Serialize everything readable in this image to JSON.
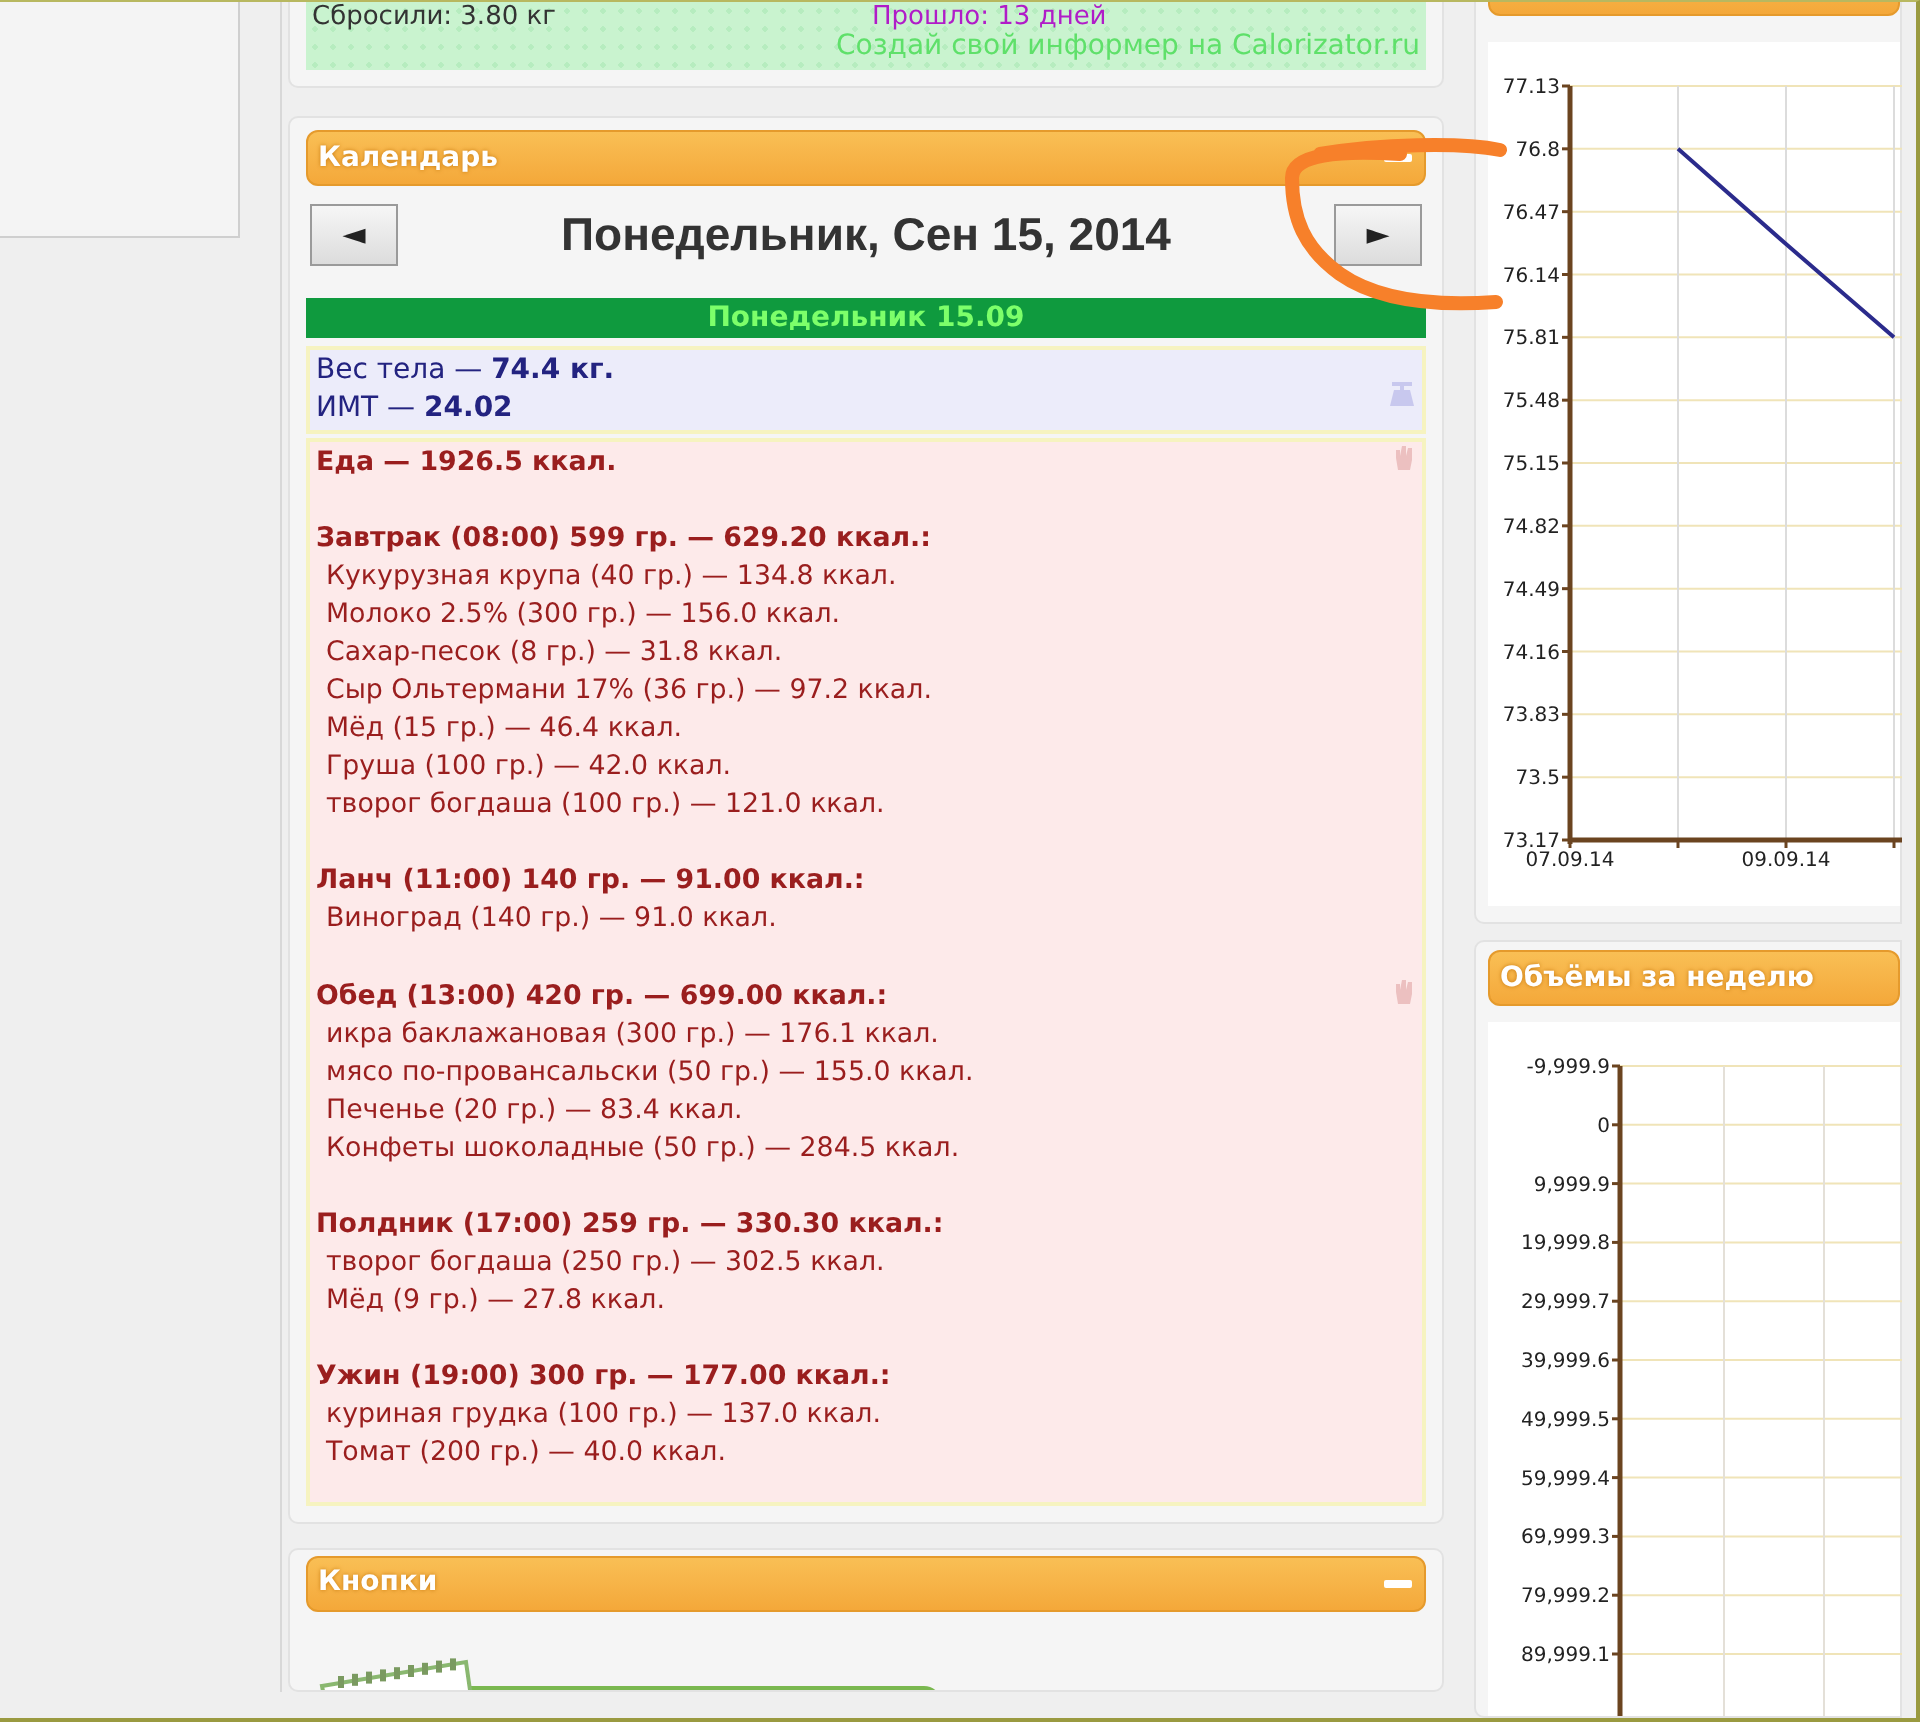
{
  "informer": {
    "lost": "Сбросили: 3.80 кг",
    "elapsed": "Прошло: 13 дней",
    "link": "Создай свой информер на Calorizator.ru"
  },
  "calendar": {
    "title": "Календарь",
    "prev": "◄",
    "date": "Понедельник, Сен 15, 2014",
    "next": "►",
    "day": "Понедельник 15.09",
    "body": [
      "Вес тела — **74.4 кг.**",
      "ИМТ — **24.02**"
    ],
    "food_total": {
      "text": "Еда — 1926.5 ккал.",
      "flagged": true
    },
    "meals": [
      {
        "title": "Завтрак (08:00) 599 гр. — 629.20 ккал.:",
        "flagged": false,
        "items": [
          "Кукурузная крупа (40 гр.) — 134.8 ккал.",
          "Молоко 2.5% (300 гр.) — 156.0 ккал.",
          "Сахар-песок (8 гр.) — 31.8 ккал.",
          "Сыр Ольтермани 17% (36 гр.) — 97.2 ккал.",
          "Мёд (15 гр.) — 46.4 ккал.",
          "Груша (100 гр.) — 42.0 ккал.",
          "творог богдаша (100 гр.) — 121.0 ккал."
        ]
      },
      {
        "title": "Ланч (11:00) 140 гр. — 91.00 ккал.:",
        "flagged": false,
        "items": [
          "Виноград (140 гр.) — 91.0 ккал."
        ]
      },
      {
        "title": "Обед (13:00) 420 гр. — 699.00 ккал.:",
        "flagged": true,
        "items": [
          "икра баклажановая (300 гр.) — 176.1 ккал.",
          "мясо по-провансальски (50 гр.) — 155.0 ккал.",
          "Печенье (20 гр.) — 83.4 ккал.",
          "Конфеты шоколадные (50 гр.) — 284.5 ккал."
        ]
      },
      {
        "title": "Полдник (17:00) 259 гр. — 330.30 ккал.:",
        "flagged": false,
        "items": [
          "творог богдаша (250 гр.) — 302.5 ккал.",
          "Мёд (9 гр.) — 27.8 ккал."
        ]
      },
      {
        "title": "Ужин (19:00) 300 гр. — 177.00 ккал.:",
        "flagged": false,
        "items": [
          "куриная грудка (100 гр.) — 137.0 ккал.",
          "Томат (200 гр.) — 40.0 ккал."
        ]
      }
    ]
  },
  "buttons_panel": {
    "title": "Кнопки"
  },
  "weight_chart": {
    "chart_data": {
      "type": "line",
      "categories": [
        "07.09.14",
        null,
        "09.09.14",
        null
      ],
      "series": [
        {
          "color": "#2b2b8c",
          "values": [
            null,
            76.8,
            76.3,
            75.81
          ]
        }
      ],
      "ylim": [
        73.17,
        77.13
      ],
      "grid": true,
      "yticks": [
        {
          "value": 77.13,
          "label": "77.13"
        },
        {
          "value": 76.8,
          "label": "76.8"
        },
        {
          "value": 76.47,
          "label": "76.47"
        },
        {
          "value": 76.14,
          "label": "76.14"
        },
        {
          "value": 75.81,
          "label": "75.81"
        },
        {
          "value": 75.48,
          "label": "75.48"
        },
        {
          "value": 75.15,
          "label": "75.15"
        },
        {
          "value": 74.82,
          "label": "74.82"
        },
        {
          "value": 74.49,
          "label": "74.49"
        },
        {
          "value": 74.16,
          "label": "74.16"
        },
        {
          "value": 73.83,
          "label": "73.83"
        },
        {
          "value": 73.5,
          "label": "73.5"
        },
        {
          "value": 73.17,
          "label": "73.17"
        }
      ]
    }
  },
  "volumes": {
    "title": "Объёмы за неделю",
    "chart_data": {
      "type": "line",
      "categories": [
        null,
        null,
        null
      ],
      "ylim": [
        99999,
        -9999.9
      ],
      "grid": true,
      "yticks": [
        {
          "value": -9999.9,
          "label": "-9,999.9"
        },
        {
          "value": 0,
          "label": "0"
        },
        {
          "value": 9999.9,
          "label": "9,999.9"
        },
        {
          "value": 19999.8,
          "label": "19,999.8"
        },
        {
          "value": 29999.7,
          "label": "29,999.7"
        },
        {
          "value": 39999.6,
          "label": "39,999.6"
        },
        {
          "value": 49999.5,
          "label": "49,999.5"
        },
        {
          "value": 59999.4,
          "label": "59,999.4"
        },
        {
          "value": 69999.3,
          "label": "69,999.3"
        },
        {
          "value": 79999.2,
          "label": "79,999.2"
        },
        {
          "value": 89999.1,
          "label": "89,999.1"
        }
      ]
    }
  }
}
